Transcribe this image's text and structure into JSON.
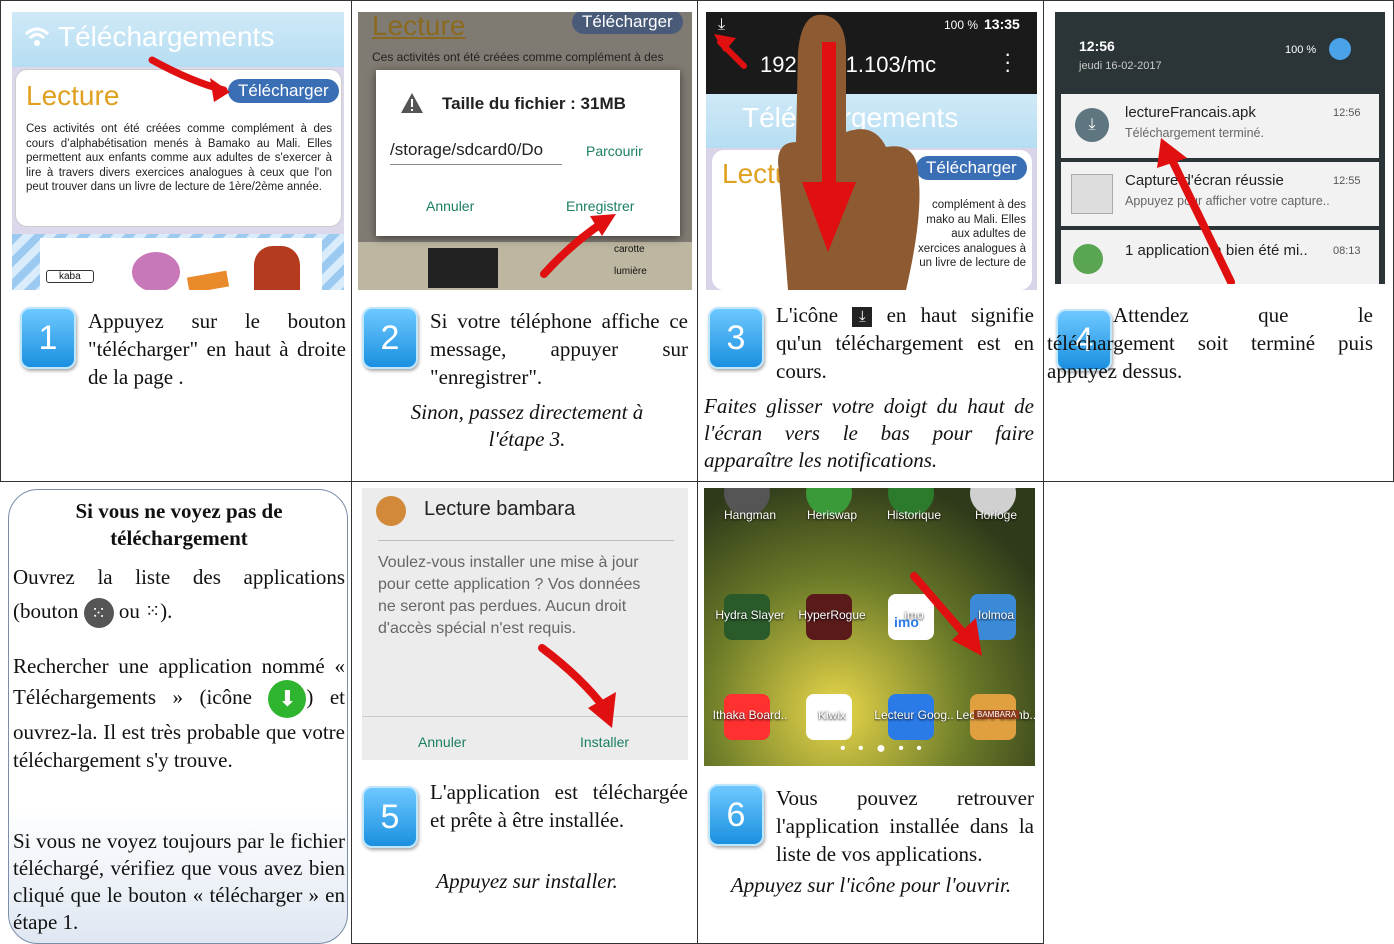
{
  "step1": {
    "num": "1",
    "app_title": "Téléchargements",
    "card_title": "Lecture",
    "download_btn": "Télécharger",
    "card_text": "Ces activités ont été créées comme complément à des cours d’alphabétisation menés à Bamako au Mali. Elles permettent aux enfants comme aux adultes de s'exercer à lire à travers divers exercices analogues à ceux que l'on peut trouver dans un livre de lecture de 1ère/2ème année.",
    "image_label": "kaba",
    "desc": "Appuyez sur le bouton \"télécharger\" en haut à droite de la page ."
  },
  "step2": {
    "num": "2",
    "bg_title": "Lecture",
    "bg_btn": "Télécharger",
    "bg_text": "Ces activités ont été créées comme complément à des",
    "dialog_title": "Taille du fichier : 31MB",
    "path": "/storage/sdcard0/Do",
    "browse": "Parcourir",
    "cancel": "Annuler",
    "save": "Enregistrer",
    "word1": "carotte",
    "word2": "lumière",
    "desc": "Si votre téléphone affiche ce message, appuyer sur \"enregistrer\".",
    "note": "Sinon, passez directement à l'étape 3."
  },
  "step3": {
    "num": "3",
    "battery": "100 %",
    "time": "13:35",
    "url": "192.168.1.103/mc",
    "app_title": "Téléchargements",
    "card_title": "Lecture",
    "download_btn": "Télécharger",
    "card_text": "complément à des mako au Mali. Elles aux adultes de xercices analogues à un livre de lecture de",
    "desc_before": "L'icône",
    "desc_after": "en haut signifie qu'un téléchargement est en cours.",
    "note": "Faites glisser votre doigt du haut de l'écran vers le bas pour faire apparaître les notifications."
  },
  "step4": {
    "num": "4",
    "time": "12:56",
    "date": "jeudi 16-02-2017",
    "battery": "100 %",
    "notif1_title": "lectureFrancais.apk",
    "notif1_time": "12:56",
    "notif1_sub": "Téléchargement terminé.",
    "notif2_title": "Capture d'écran réussie",
    "notif2_time": "12:55",
    "notif2_sub": "Appuyez pour afficher votre capture..",
    "notif3_title": "1 application a bien été mi..",
    "notif3_time": "08:13",
    "desc": "Attendez que le téléchargement soit terminé puis appuyez dessus."
  },
  "tip": {
    "title": "Si vous ne voyez pas de téléchargement",
    "p1_a": "Ouvrez la liste des applications (bouton",
    "p1_b": "ou",
    "p1_c": ").",
    "p2_a": "Rechercher une application nommé « Téléchargements » (icône",
    "p2_b": ") et ouvrez-la. Il est très probable que votre téléchargement s'y trouve.",
    "p3": "Si vous ne voyez toujours par le fichier téléchargé, vérifiez que vous avez bien cliqué que le bouton « télécharger » en étape 1."
  },
  "step5": {
    "num": "5",
    "app_name": "Lecture bambara",
    "message": "Voulez-vous installer une mise à jour pour cette application ? Vos données ne seront pas perdues. Aucun droit d'accès spécial n'est requis.",
    "cancel": "Annuler",
    "install": "Installer",
    "desc": "L'application est téléchargée et prête à être installée.",
    "note": "Appuyez sur installer."
  },
  "step6": {
    "num": "6",
    "apps_row1": [
      "Hangman",
      "Heriswap",
      "Historique",
      "Horloge"
    ],
    "apps_row2": [
      "Hydra Slayer",
      "HyperRogue",
      "imo",
      "Iolmoa"
    ],
    "apps_row3": [
      "Ithaka Board..",
      "Kiwix",
      "Lecteur Goog..",
      "Lecture bamb.."
    ],
    "imo_text": "imo",
    "bambara_badge": "BAMBARA",
    "desc": "Vous pouvez retrouver l'application installée dans la liste de vos applications.",
    "note": "Appuyez sur l'icône pour l'ouvrir."
  },
  "colors": {
    "accent": "#2d8be0",
    "arrow_red": "#e01010",
    "title_orange": "#e0a020"
  }
}
